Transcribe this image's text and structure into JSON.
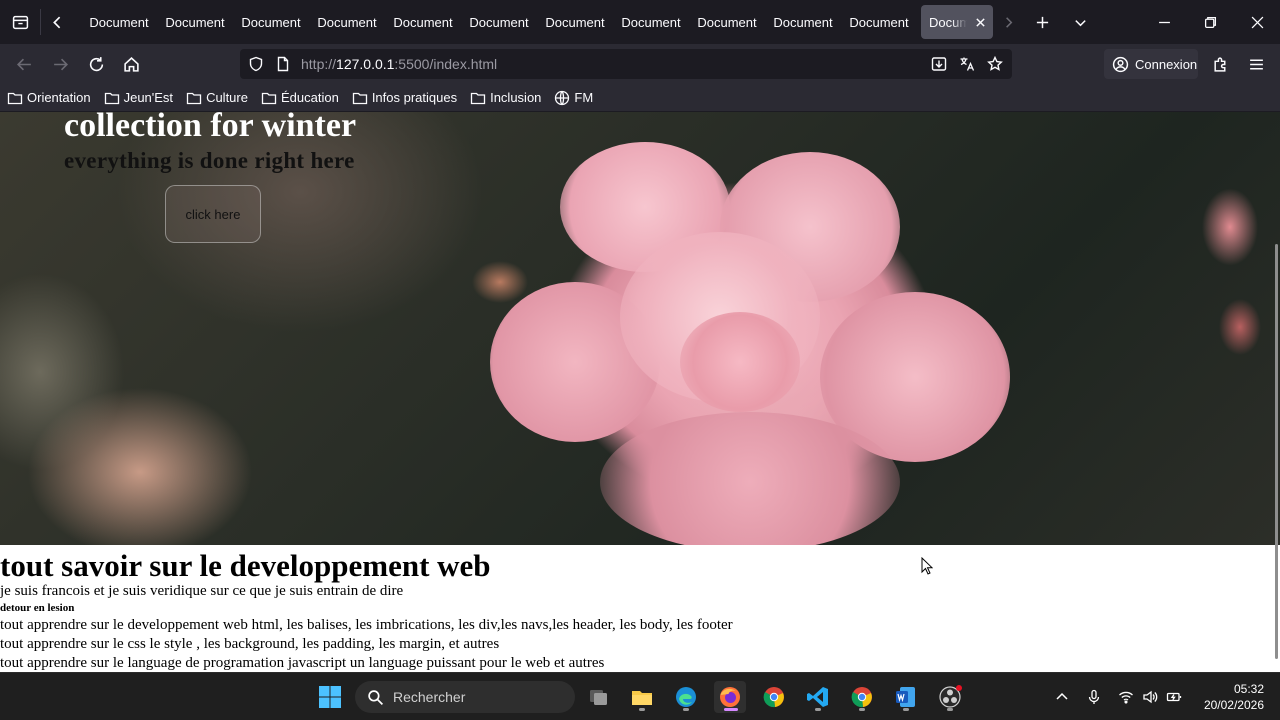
{
  "browser": {
    "tabs": [
      {
        "label": "Document"
      },
      {
        "label": "Document"
      },
      {
        "label": "Document"
      },
      {
        "label": "Document"
      },
      {
        "label": "Document"
      },
      {
        "label": "Document"
      },
      {
        "label": "Document"
      },
      {
        "label": "Document"
      },
      {
        "label": "Document"
      },
      {
        "label": "Document"
      },
      {
        "label": "Document"
      }
    ],
    "active_tab": {
      "label": "Document"
    },
    "url": {
      "scheme": "http://",
      "host": "127.0.0.1",
      "rest": ":5500/index.html"
    },
    "signin_label": "Connexion",
    "bookmarks": [
      {
        "label": "Orientation",
        "icon": "folder-icon"
      },
      {
        "label": "Jeun'Est",
        "icon": "folder-icon"
      },
      {
        "label": "Culture",
        "icon": "folder-icon"
      },
      {
        "label": "Éducation",
        "icon": "folder-icon"
      },
      {
        "label": "Infos pratiques",
        "icon": "folder-icon"
      },
      {
        "label": "Inclusion",
        "icon": "folder-icon"
      },
      {
        "label": "FM",
        "icon": "globe-icon"
      }
    ]
  },
  "page": {
    "hero": {
      "title": "collection for winter",
      "subtitle": "everything is done right here",
      "button_label": "click here"
    },
    "article": {
      "heading": "tout savoir sur le developpement web",
      "intro": "je suis francois et je suis veridique sur ce que je suis entrain de dire",
      "small_bold": "detour en lesion",
      "lines": [
        "tout apprendre sur le developpement web html, les balises, les imbrications, les div,les navs,les header, les body, les footer",
        "tout apprendre sur le css le style , les background, les padding, les margin, et autres",
        "tout apprendre sur le language de programation javascript un language puissant pour le web et autres"
      ]
    }
  },
  "taskbar": {
    "search_placeholder": "Rechercher",
    "time": "05:32",
    "date": "20/02/2026",
    "apps": [
      "task-view",
      "file-explorer",
      "edge",
      "firefox",
      "chrome",
      "vscode",
      "chrome",
      "word",
      "obs"
    ]
  },
  "colors": {
    "accent": "#d488ff",
    "chrome_dark": "#1c1b22",
    "chrome_mid": "#2b2a33",
    "petal_pink": "#f3bcc6"
  }
}
